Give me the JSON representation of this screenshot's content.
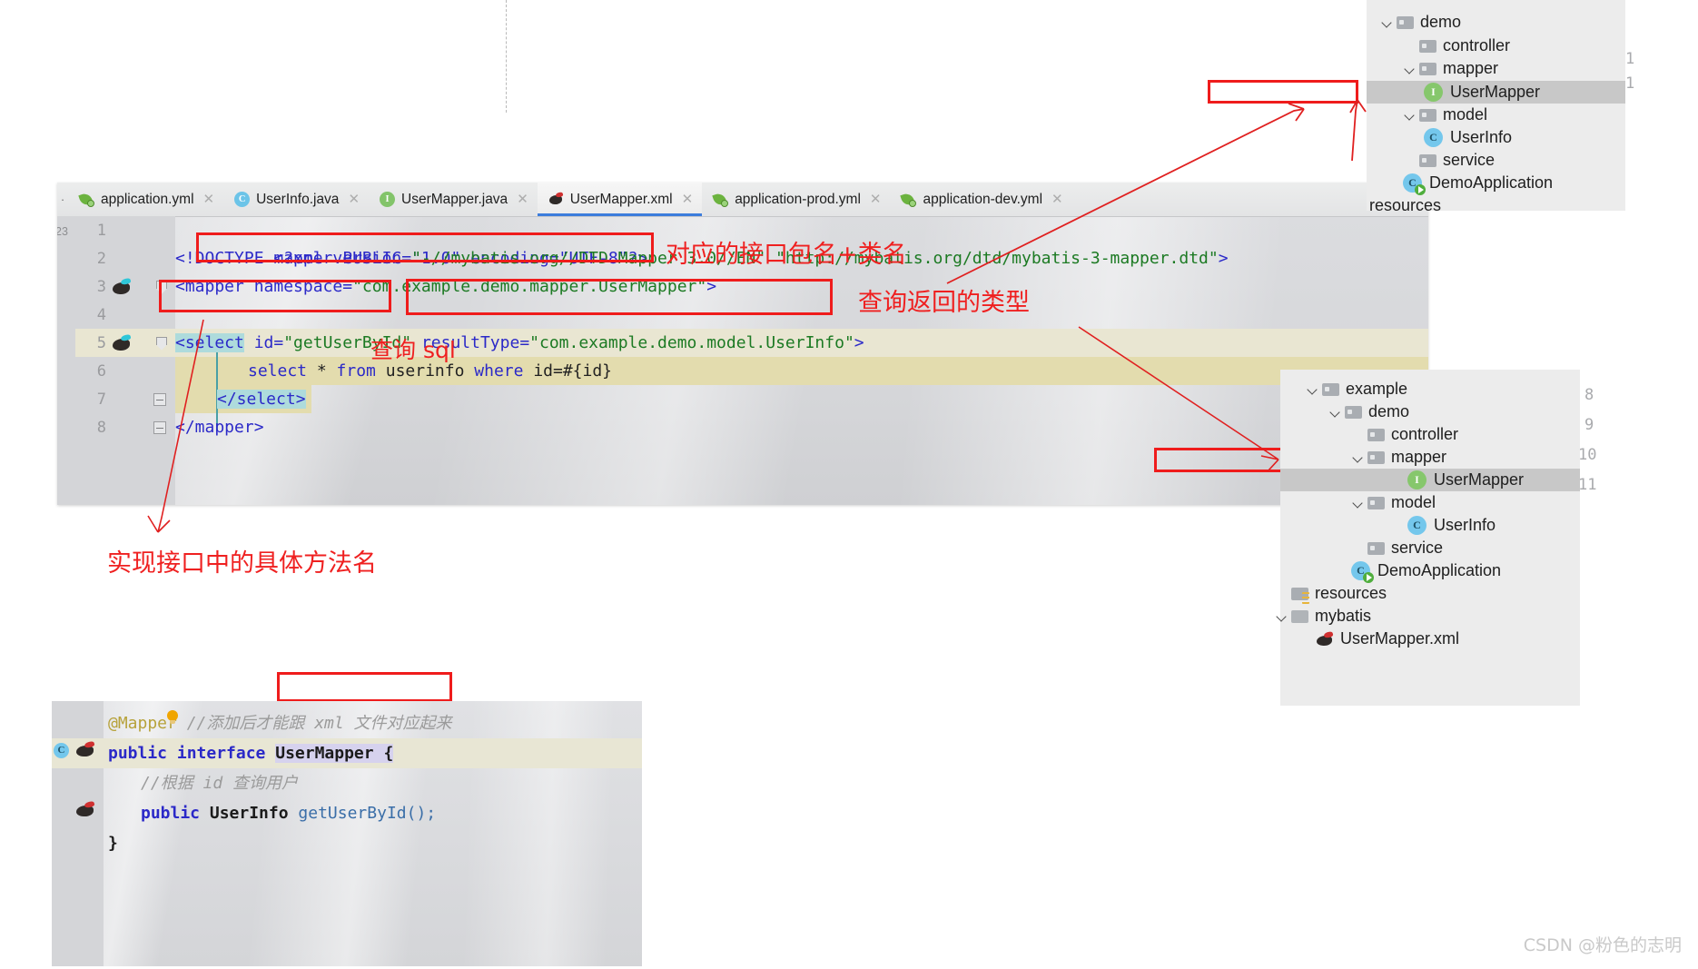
{
  "editor": {
    "tabs": [
      {
        "label": "application.yml",
        "icon": "yml-icon",
        "active": false,
        "closable": true
      },
      {
        "label": "UserInfo.java",
        "icon": "class-icon",
        "active": false,
        "closable": true
      },
      {
        "label": "UserMapper.java",
        "icon": "interface-icon",
        "active": false,
        "closable": true
      },
      {
        "label": "UserMapper.xml",
        "icon": "xml-mybatis-icon",
        "active": true,
        "closable": true
      },
      {
        "label": "application-prod.yml",
        "icon": "yml-icon",
        "active": false,
        "closable": true
      },
      {
        "label": "application-dev.yml",
        "icon": "yml-icon",
        "active": false,
        "closable": true
      }
    ],
    "gutter_marker": "23",
    "line_numbers": [
      "1",
      "2",
      "3",
      "4",
      "5",
      "6",
      "7",
      "8"
    ],
    "code": {
      "line1": "<?xml version=\"1.0\" encoding=\"UTF-8\"?>",
      "line1_parts": {
        "open": "<?",
        "name": "xml",
        "attr1": "version",
        "val1": "\"1.0\"",
        "attr2": "encoding",
        "val2": "\"UTF-8\"",
        "close": "?>"
      },
      "line2": "<!DOCTYPE mapper PUBLIC \"-//mybatis.org//DTD Mapper 3.0//EN\" \"http://mybatis.org/dtd/mybatis-3-mapper.dtd\">",
      "line2_tag": "<!DOCTYPE mapper PUBLIC ",
      "line2_str1": "\"-//mybatis.org//DTD Mapper 3.0//EN\"",
      "line2_str2": " \"http://mybatis.org/dtd/mybatis-3-mapper.dtd\"",
      "line2_end": ">",
      "line3_tag": "<mapper ",
      "line3_attr": "namespace=",
      "line3_val": "\"com.example.demo.mapper.UserMapper\"",
      "line3_end": ">",
      "line5_tag": "<select",
      "line5_attr1": " id=",
      "line5_val1": "\"getUserById\"",
      "line5_attr2": " resultType=",
      "line5_val2": "\"com.example.demo.model.UserInfo\"",
      "line5_end": ">",
      "line6": "select * from userinfo where id=#{id}",
      "line6_p1": "select ",
      "line6_p2": "* ",
      "line6_p3": "from ",
      "line6_p4": "userinfo ",
      "line6_p5": "where ",
      "line6_p6": "id=#{id}",
      "line7": "</select>",
      "line8": "</mapper>"
    }
  },
  "annotations": {
    "namespace_note": "对应的接口包名+类名",
    "resulttype_note": "查询返回的类型",
    "sql_note": "查询 sql",
    "method_note": "实现接口中的具体方法名"
  },
  "tree_top": {
    "rows": [
      {
        "label": "demo",
        "depth": 0,
        "icon": "folder-icon",
        "chevron": true,
        "selected": false,
        "boxed": false
      },
      {
        "label": "controller",
        "depth": 1,
        "icon": "folder-icon",
        "chevron": false,
        "selected": false,
        "boxed": false
      },
      {
        "label": "mapper",
        "depth": 1,
        "icon": "folder-icon",
        "chevron": true,
        "selected": false,
        "boxed": false
      },
      {
        "label": "UserMapper",
        "depth": 2,
        "icon": "interface-icon",
        "chevron": false,
        "selected": true,
        "boxed": true
      },
      {
        "label": "model",
        "depth": 1,
        "icon": "folder-icon",
        "chevron": true,
        "selected": false,
        "boxed": false
      },
      {
        "label": "UserInfo",
        "depth": 2,
        "icon": "class-icon",
        "chevron": false,
        "selected": false,
        "boxed": false
      },
      {
        "label": "service",
        "depth": 1,
        "icon": "folder-icon",
        "chevron": false,
        "selected": false,
        "boxed": false
      },
      {
        "label": "DemoApplication",
        "depth": 1,
        "icon": "spring-app-icon",
        "chevron": false,
        "selected": false,
        "boxed": false
      }
    ],
    "partial_row": "resources",
    "peek_numbers": [
      "1",
      "1"
    ]
  },
  "tree_bottom": {
    "rows": [
      {
        "label": "example",
        "depth": 0,
        "icon": "folder-icon",
        "chevron": true,
        "selected": false,
        "boxed": false
      },
      {
        "label": "demo",
        "depth": 1,
        "icon": "folder-icon",
        "chevron": true,
        "selected": false,
        "boxed": false
      },
      {
        "label": "controller",
        "depth": 2,
        "icon": "folder-icon",
        "chevron": false,
        "selected": false,
        "boxed": false
      },
      {
        "label": "mapper",
        "depth": 2,
        "icon": "folder-icon",
        "chevron": true,
        "selected": false,
        "boxed": false
      },
      {
        "label": "UserMapper",
        "depth": 3,
        "icon": "interface-icon",
        "chevron": false,
        "selected": true,
        "boxed": false
      },
      {
        "label": "model",
        "depth": 2,
        "icon": "folder-icon",
        "chevron": true,
        "selected": false,
        "boxed": false
      },
      {
        "label": "UserInfo",
        "depth": 3,
        "icon": "class-icon",
        "chevron": false,
        "selected": false,
        "boxed": true
      },
      {
        "label": "service",
        "depth": 2,
        "icon": "folder-icon",
        "chevron": false,
        "selected": false,
        "boxed": false
      },
      {
        "label": "DemoApplication",
        "depth": 2,
        "icon": "spring-app-icon",
        "chevron": false,
        "selected": false,
        "boxed": false
      },
      {
        "label": "resources",
        "depth": 0,
        "icon": "resources-folder-icon",
        "chevron": false,
        "selected": false,
        "boxed": false
      },
      {
        "label": "mybatis",
        "depth": 0,
        "icon": "folder-plain-icon",
        "chevron": true,
        "selected": false,
        "boxed": false
      },
      {
        "label": "UserMapper.xml",
        "depth": 1,
        "icon": "xml-mybatis-icon",
        "chevron": false,
        "selected": false,
        "boxed": false
      }
    ],
    "peek_numbers": [
      "8",
      "9",
      "10",
      "11"
    ]
  },
  "java_snippet": {
    "annotation": "@Mapper",
    "annotation_comment": " //添加后才能跟 xml 文件对应起来",
    "decl_kw1": "public ",
    "decl_kw2": "interface ",
    "decl_name": "UserMapper",
    "decl_brace": " {",
    "comment2": "//根据 id 查询用户",
    "method_kw": "public ",
    "method_type": "UserInfo ",
    "method_name": "getUserById();",
    "close_brace": "}"
  },
  "watermark": "CSDN @粉色的志明",
  "colors": {
    "annotation_red": "#ef2020",
    "box_red": "#ef1c1c",
    "tab_active_underline": "#3c7ddc",
    "selection_cyan": "#aedbdc",
    "current_line": "#e9e6d2"
  }
}
